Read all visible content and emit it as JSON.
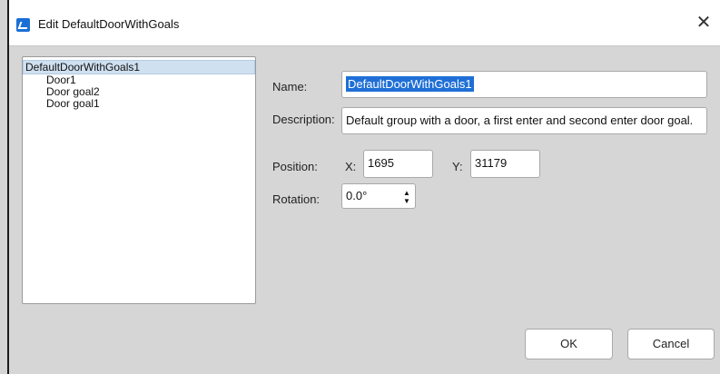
{
  "window": {
    "title": "Edit DefaultDoorWithGoals"
  },
  "tree": {
    "root": "DefaultDoorWithGoals1",
    "children": [
      "Door1",
      "Door goal2",
      "Door goal1"
    ]
  },
  "form": {
    "name_label": "Name:",
    "name_value": "DefaultDoorWithGoals1",
    "description_label": "Description:",
    "description_value": "Default group with a door, a first enter and second enter door goal.",
    "position_label": "Position:",
    "x_label": "X:",
    "x_value": "1695",
    "y_label": "Y:",
    "y_value": "31179",
    "rotation_label": "Rotation:",
    "rotation_value": "0.0°"
  },
  "buttons": {
    "ok": "OK",
    "cancel": "Cancel"
  },
  "colors": {
    "selection": "#1f6fd6",
    "tree_selected": "#cfe0f0",
    "icon": "#1a6fd6"
  },
  "icons": {
    "app": "app-icon",
    "close": "close-icon",
    "spinner": "spinner-arrows-icon"
  }
}
